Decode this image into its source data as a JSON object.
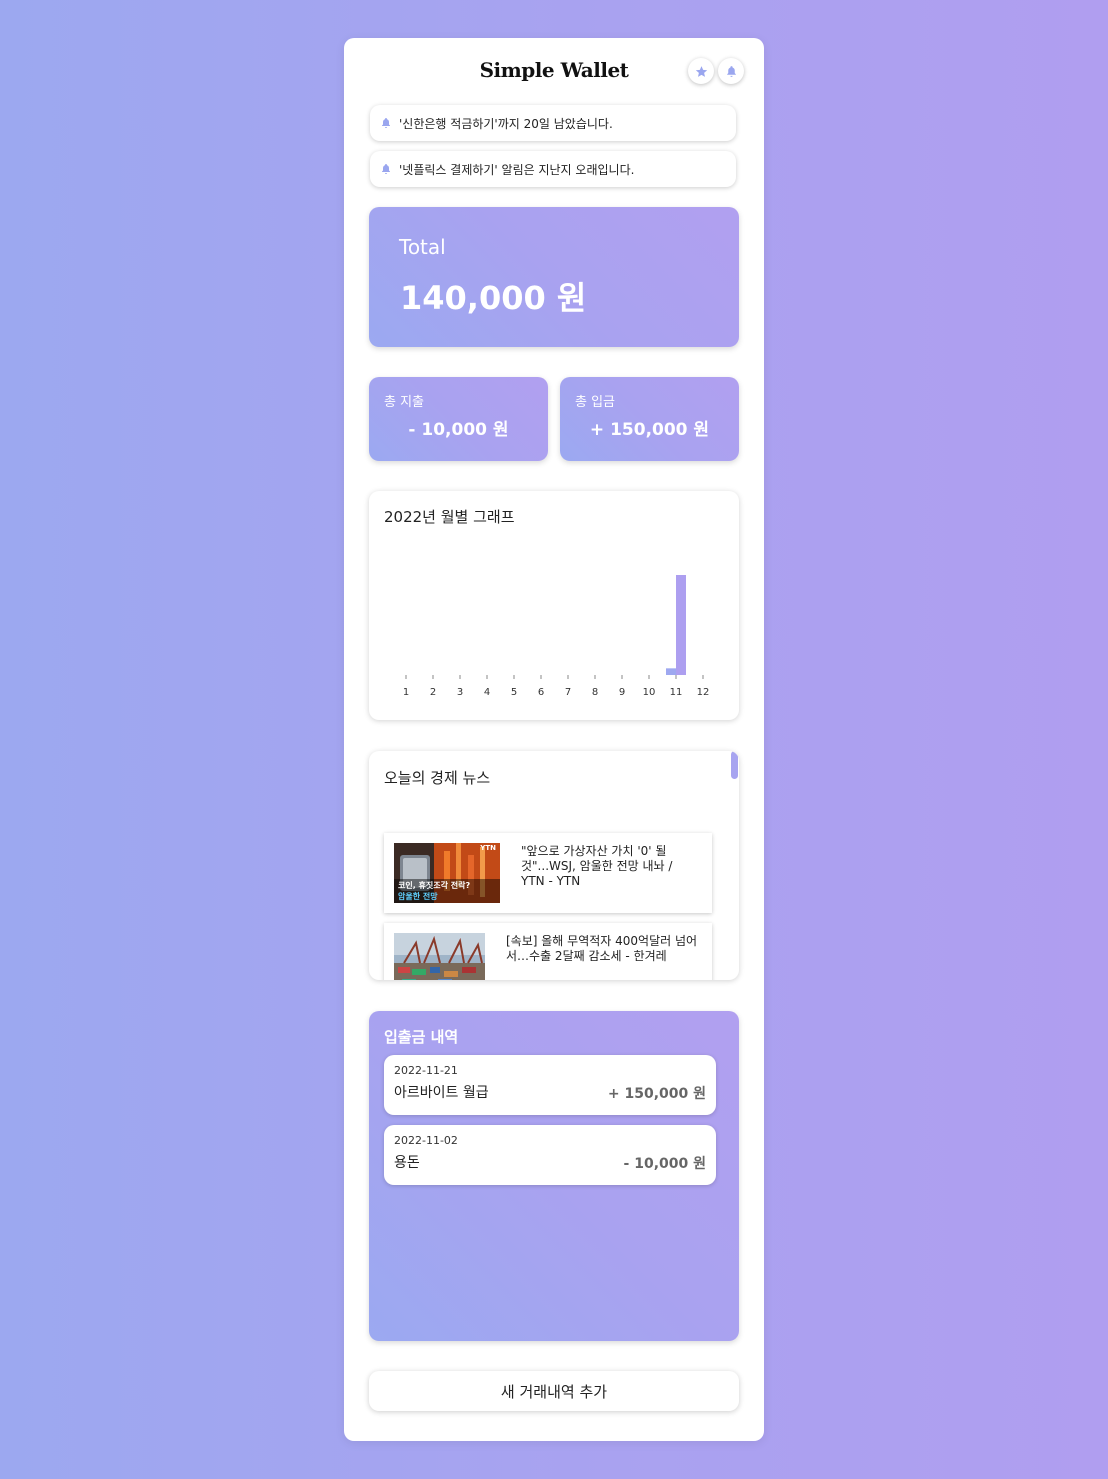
{
  "app": {
    "title": "Simple Wallet",
    "header_icons": [
      "star-icon",
      "bell-icon"
    ],
    "accent_color": "#9ca8f0"
  },
  "notifications": [
    {
      "text": "'신한은행 적금하기'까지 20일 남았습니다.",
      "icon": "bell-icon"
    },
    {
      "text": "'넷플릭스 결제하기' 알림은 지난지 오래입니다.",
      "icon": "bell-icon"
    }
  ],
  "total": {
    "label": "Total",
    "amount": "140,000 원"
  },
  "summary": {
    "expense": {
      "label": "총 지출",
      "amount": "- 10,000 원"
    },
    "income": {
      "label": "총 입금",
      "amount": "+ 150,000 원"
    }
  },
  "chart": {
    "title": "2022년 월별 그래프"
  },
  "chart_data": {
    "type": "bar",
    "categories": [
      "1",
      "2",
      "3",
      "4",
      "5",
      "6",
      "7",
      "8",
      "9",
      "10",
      "11",
      "12"
    ],
    "series": [
      {
        "values": [
          0,
          0,
          0,
          0,
          0,
          0,
          0,
          0,
          0,
          0,
          10000,
          0
        ],
        "color": "#9ea8f0"
      },
      {
        "values": [
          0,
          0,
          0,
          0,
          0,
          0,
          0,
          0,
          0,
          0,
          150000,
          0
        ],
        "color": "#ad9ff0"
      }
    ],
    "ylim": [
      0,
      150000
    ],
    "grid": false
  },
  "news": {
    "title": "오늘의 경제 뉴스",
    "items": [
      {
        "headline": "\"앞으로 가상자산 가치 '0' 될 것\"...WSJ, 암울한 전망 내놔 / YTN - YTN",
        "thumb_caption_line1": "코인, 휴짓조각 전락?",
        "thumb_caption_line2": "암울한 전망",
        "thumb_logo": "YTN"
      },
      {
        "headline": "[속보] 올해 무역적자 400억달러 넘어서…수출 2달째 감소세 - 한겨레"
      }
    ]
  },
  "transactions": {
    "title": "입출금 내역",
    "items": [
      {
        "date": "2022-11-21",
        "description": "아르바이트 월급",
        "amount": "+ 150,000 원"
      },
      {
        "date": "2022-11-02",
        "description": "용돈",
        "amount": "- 10,000 원"
      }
    ]
  },
  "add_button": {
    "label": "새 거래내역 추가"
  }
}
